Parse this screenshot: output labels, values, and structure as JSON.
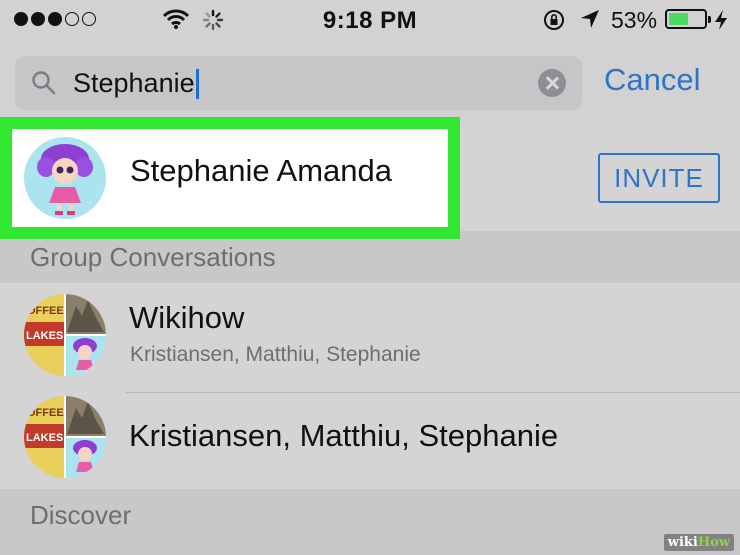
{
  "status_bar": {
    "time": "9:18 PM",
    "battery_percent": "53%",
    "battery_level": 0.53,
    "signal_bars_filled": 3,
    "signal_bars_total": 5
  },
  "search": {
    "query": "Stephanie",
    "cancel_label": "Cancel"
  },
  "contact": {
    "name": "Stephanie Amanda",
    "invite_label": "INVITE"
  },
  "sections": {
    "group_conversations": "Group Conversations",
    "discover": "Discover"
  },
  "groups": [
    {
      "title": "Wikihow",
      "members": "Kristiansen, Matthiu, Stephanie"
    },
    {
      "title": "Kristiansen, Matthiu, Stephanie"
    }
  ],
  "watermark": {
    "part1": "wiki",
    "part2": "How"
  },
  "colors": {
    "accent": "#2f74c7",
    "highlight": "#2fe82f",
    "battery": "#4cd964",
    "caret": "#1c6fd1"
  }
}
